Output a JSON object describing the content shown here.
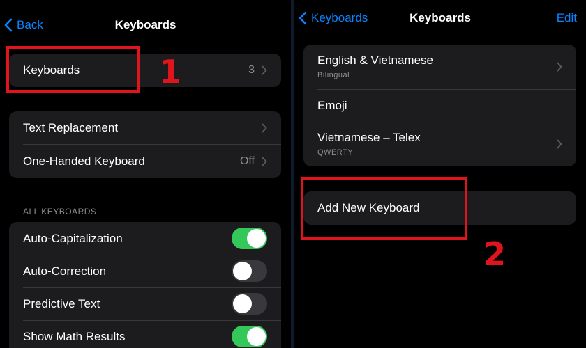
{
  "left": {
    "nav": {
      "back_label": "Back",
      "title": "Keyboards"
    },
    "keyboards_row": {
      "label": "Keyboards",
      "count": "3"
    },
    "group2": [
      {
        "label": "Text Replacement",
        "value": ""
      },
      {
        "label": "One-Handed Keyboard",
        "value": "Off"
      }
    ],
    "section_header": "ALL KEYBOARDS",
    "toggles": [
      {
        "label": "Auto-Capitalization",
        "state": "on"
      },
      {
        "label": "Auto-Correction",
        "state": "off"
      },
      {
        "label": "Predictive Text",
        "state": "off"
      },
      {
        "label": "Show Math Results",
        "state": "on"
      }
    ],
    "step_marker": "1"
  },
  "right": {
    "nav": {
      "back_label": "Keyboards",
      "title": "Keyboards",
      "edit_label": "Edit"
    },
    "keyboards": [
      {
        "label": "English & Vietnamese",
        "sublabel": "Bilingual"
      },
      {
        "label": "Emoji",
        "sublabel": ""
      },
      {
        "label": "Vietnamese – Telex",
        "sublabel": "QWERTY"
      }
    ],
    "add_label": "Add New Keyboard",
    "step_marker": "2"
  },
  "colors": {
    "background": "#000000",
    "cell": "#1c1c1e",
    "accent": "#0a84ff",
    "toggle_on": "#34c759",
    "annotation": "#e0141d"
  },
  "icons": [
    "chevron-left-icon",
    "chevron-right-icon"
  ]
}
